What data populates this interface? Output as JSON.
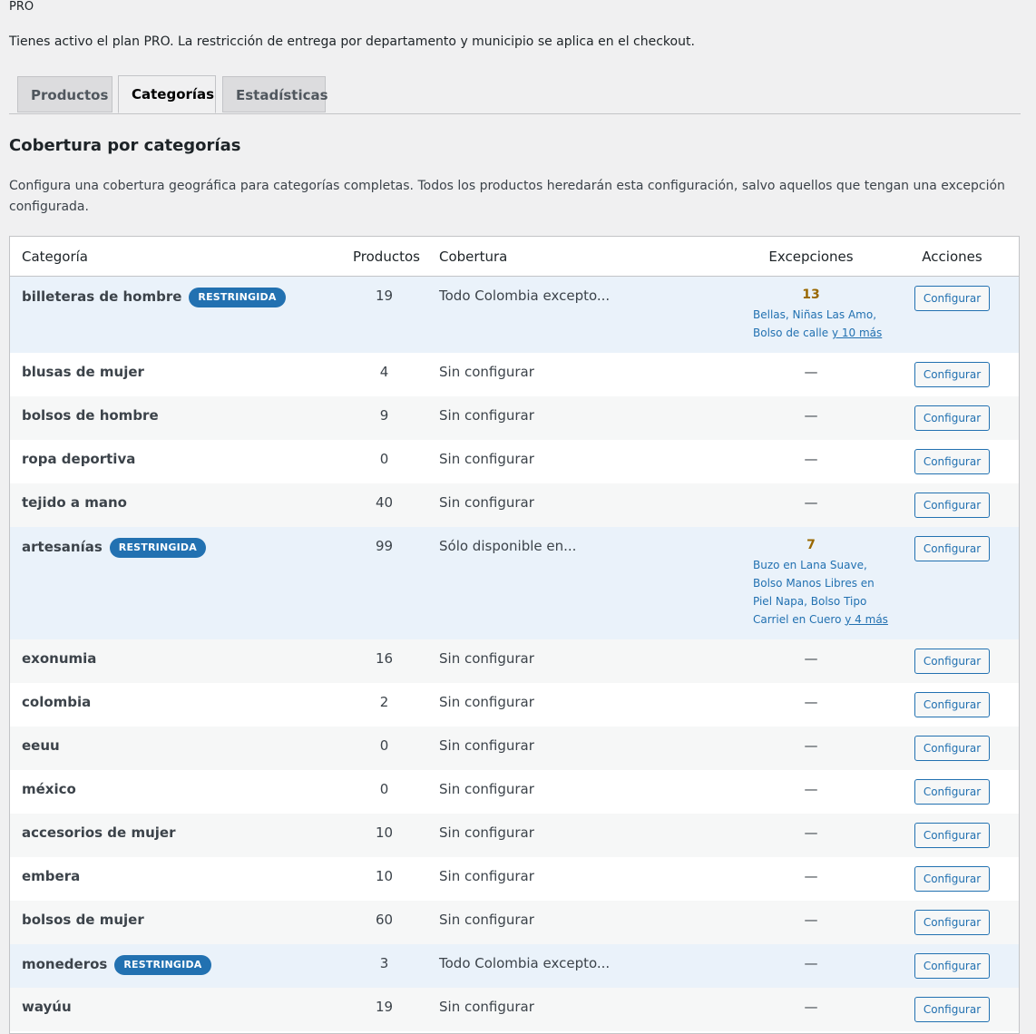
{
  "header": {
    "plan": "PRO",
    "notice": "Tienes activo el plan PRO. La restricción de entrega por departamento y municipio se aplica en el checkout."
  },
  "tabs": [
    {
      "label": "Productos",
      "active": false
    },
    {
      "label": "Categorías",
      "active": true
    },
    {
      "label": "Estadísticas",
      "active": false
    }
  ],
  "section": {
    "title": "Cobertura por categorías",
    "description": "Configura una cobertura geográfica para categorías completas. Todos los productos heredarán esta configuración, salvo aquellos que tengan una excepción configurada."
  },
  "table": {
    "headers": {
      "category": "Categoría",
      "products": "Productos",
      "coverage": "Cobertura",
      "exceptions": "Excepciones",
      "actions": "Acciones"
    },
    "configure_label": "Configurar",
    "restricted_label": "RESTRINGIDA",
    "empty_dash": "—",
    "rows": [
      {
        "name": "billeteras de hombre",
        "restricted": true,
        "count": "19",
        "coverage": "Todo Colombia excepto...",
        "exceptions_count": "13",
        "exceptions_names": "Bellas, Niñas Las Amo, Bolso de calle",
        "exceptions_more": "y 10 más"
      },
      {
        "name": "blusas de mujer",
        "restricted": false,
        "count": "4",
        "coverage": "Sin configurar"
      },
      {
        "name": "bolsos de hombre",
        "restricted": false,
        "count": "9",
        "coverage": "Sin configurar"
      },
      {
        "name": "ropa deportiva",
        "restricted": false,
        "count": "0",
        "coverage": "Sin configurar"
      },
      {
        "name": "tejido a mano",
        "restricted": false,
        "count": "40",
        "coverage": "Sin configurar"
      },
      {
        "name": "artesanías",
        "restricted": true,
        "count": "99",
        "coverage": "Sólo disponible en...",
        "exceptions_count": "7",
        "exceptions_names": "Buzo en Lana Suave, Bolso Manos Libres en Piel Napa, Bolso Tipo Carriel en Cuero",
        "exceptions_more": "y 4 más"
      },
      {
        "name": "exonumia",
        "restricted": false,
        "count": "16",
        "coverage": "Sin configurar"
      },
      {
        "name": "colombia",
        "restricted": false,
        "count": "2",
        "coverage": "Sin configurar"
      },
      {
        "name": "eeuu",
        "restricted": false,
        "count": "0",
        "coverage": "Sin configurar"
      },
      {
        "name": "méxico",
        "restricted": false,
        "count": "0",
        "coverage": "Sin configurar"
      },
      {
        "name": "accesorios de mujer",
        "restricted": false,
        "count": "10",
        "coverage": "Sin configurar"
      },
      {
        "name": "embera",
        "restricted": false,
        "count": "10",
        "coverage": "Sin configurar"
      },
      {
        "name": "bolsos de mujer",
        "restricted": false,
        "count": "60",
        "coverage": "Sin configurar"
      },
      {
        "name": "monederos",
        "restricted": true,
        "count": "3",
        "coverage": "Todo Colombia excepto..."
      },
      {
        "name": "wayúu",
        "restricted": false,
        "count": "19",
        "coverage": "Sin configurar"
      }
    ]
  }
}
